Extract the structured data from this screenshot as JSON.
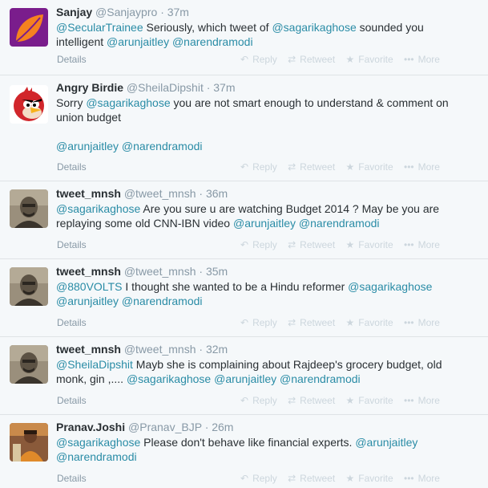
{
  "actions": {
    "reply": "Reply",
    "retweet": "Retweet",
    "favorite": "Favorite",
    "more": "More",
    "details": "Details"
  },
  "colors": {
    "link": "#2a8ca6",
    "muted": "#8899a6",
    "actions": "#ccd6dd"
  },
  "tweets": [
    {
      "fullname": "Sanjay",
      "username": "@Sanjaypro",
      "time": "· 37m",
      "avatar": "orange-leaf-logo",
      "segments": [
        {
          "t": "@SecularTrainee",
          "m": true
        },
        {
          "t": " Seriously, which tweet of "
        },
        {
          "t": "@sagarikaghose",
          "m": true
        },
        {
          "t": " sounded you intelligent  "
        },
        {
          "t": "@arunjaitley",
          "m": true
        },
        {
          "t": " "
        },
        {
          "t": "@narendramodi",
          "m": true
        }
      ]
    },
    {
      "fullname": "Angry Birdie",
      "username": "@SheilaDipshit",
      "time": "· 37m",
      "avatar": "red-angry-bird",
      "segments": [
        {
          "t": "Sorry "
        },
        {
          "t": "@sagarikaghose",
          "m": true
        },
        {
          "t": " you are not smart enough to understand & comment on union budget"
        }
      ],
      "extra": [
        {
          "t": "@arunjaitley",
          "m": true
        },
        {
          "t": " "
        },
        {
          "t": "@narendramodi",
          "m": true
        }
      ]
    },
    {
      "fullname": "tweet_mnsh",
      "username": "@tweet_mnsh",
      "time": "· 36m",
      "avatar": "sepia-portrait",
      "segments": [
        {
          "t": "@sagarikaghose",
          "m": true
        },
        {
          "t": " Are you sure u are watching Budget 2014 ? May be you are replaying some old CNN-IBN video "
        },
        {
          "t": "@arunjaitley",
          "m": true
        },
        {
          "t": " "
        },
        {
          "t": "@narendramodi",
          "m": true
        }
      ]
    },
    {
      "fullname": "tweet_mnsh",
      "username": "@tweet_mnsh",
      "time": "· 35m",
      "avatar": "sepia-portrait",
      "segments": [
        {
          "t": "@880VOLTS",
          "m": true
        },
        {
          "t": " I thought she wanted to be a Hindu reformer "
        },
        {
          "t": "@sagarikaghose",
          "m": true
        },
        {
          "t": " "
        },
        {
          "t": "@arunjaitley",
          "m": true
        },
        {
          "t": " "
        },
        {
          "t": "@narendramodi",
          "m": true
        }
      ]
    },
    {
      "fullname": "tweet_mnsh",
      "username": "@tweet_mnsh",
      "time": "· 32m",
      "avatar": "sepia-portrait",
      "segments": [
        {
          "t": "@SheilaDipshit",
          "m": true
        },
        {
          "t": " Mayb she is complaining about Rajdeep's grocery budget, old monk, gin ,.... "
        },
        {
          "t": "@sagarikaghose",
          "m": true
        },
        {
          "t": " "
        },
        {
          "t": "@arunjaitley",
          "m": true
        },
        {
          "t": " "
        },
        {
          "t": "@narendramodi",
          "m": true
        }
      ]
    },
    {
      "fullname": "Pranav.Joshi",
      "username": "@Pranav_BJP",
      "time": "· 26m",
      "avatar": "photo-portrait",
      "segments": [
        {
          "t": "@sagarikaghose",
          "m": true
        },
        {
          "t": " Please don't behave like financial experts. "
        },
        {
          "t": "@arunjaitley",
          "m": true
        },
        {
          "t": " "
        },
        {
          "t": "@narendramodi",
          "m": true
        }
      ]
    }
  ]
}
